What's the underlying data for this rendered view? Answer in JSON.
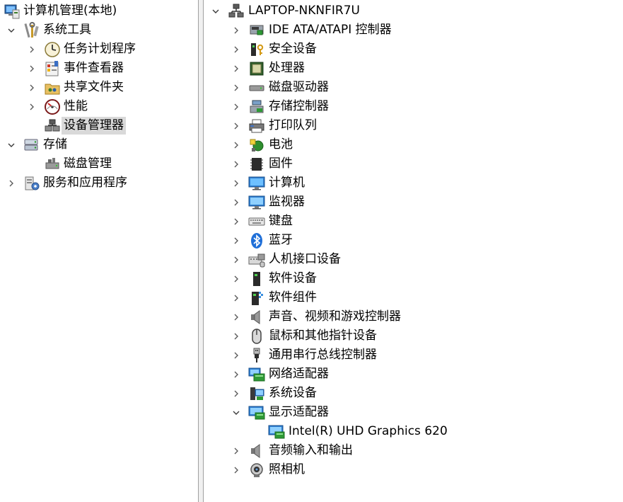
{
  "left_tree": {
    "root": {
      "label": "计算机管理(本地)",
      "icon": "computer-management-icon"
    },
    "items": [
      {
        "label": "系统工具",
        "icon": "system-tools-icon",
        "state": "expanded"
      },
      {
        "label": "任务计划程序",
        "icon": "task-scheduler-icon",
        "state": "collapsed"
      },
      {
        "label": "事件查看器",
        "icon": "event-viewer-icon",
        "state": "collapsed"
      },
      {
        "label": "共享文件夹",
        "icon": "shared-folders-icon",
        "state": "collapsed"
      },
      {
        "label": "性能",
        "icon": "performance-icon",
        "state": "collapsed"
      },
      {
        "label": "设备管理器",
        "icon": "device-manager-icon",
        "state": "leaf",
        "selected": true
      },
      {
        "label": "存储",
        "icon": "storage-icon",
        "state": "expanded"
      },
      {
        "label": "磁盘管理",
        "icon": "disk-management-icon",
        "state": "leaf"
      },
      {
        "label": "服务和应用程序",
        "icon": "services-applications-icon",
        "state": "collapsed"
      }
    ]
  },
  "device_tree": {
    "root": {
      "label": "LAPTOP-NKNFIR7U",
      "icon": "computer-network-icon",
      "state": "expanded"
    },
    "categories": [
      {
        "label": "IDE ATA/ATAPI 控制器",
        "icon": "ide-controller-icon",
        "state": "collapsed"
      },
      {
        "label": "安全设备",
        "icon": "security-device-icon",
        "state": "collapsed"
      },
      {
        "label": "处理器",
        "icon": "processor-icon",
        "state": "collapsed"
      },
      {
        "label": "磁盘驱动器",
        "icon": "disk-drive-icon",
        "state": "collapsed"
      },
      {
        "label": "存储控制器",
        "icon": "storage-controller-icon",
        "state": "collapsed"
      },
      {
        "label": "打印队列",
        "icon": "printer-icon",
        "state": "collapsed"
      },
      {
        "label": "电池",
        "icon": "battery-icon",
        "state": "collapsed"
      },
      {
        "label": "固件",
        "icon": "firmware-icon",
        "state": "collapsed"
      },
      {
        "label": "计算机",
        "icon": "computer-icon",
        "state": "collapsed"
      },
      {
        "label": "监视器",
        "icon": "monitor-icon",
        "state": "collapsed"
      },
      {
        "label": "键盘",
        "icon": "keyboard-icon",
        "state": "collapsed"
      },
      {
        "label": "蓝牙",
        "icon": "bluetooth-icon",
        "state": "collapsed"
      },
      {
        "label": "人机接口设备",
        "icon": "hid-icon",
        "state": "collapsed"
      },
      {
        "label": "软件设备",
        "icon": "software-device-icon",
        "state": "collapsed"
      },
      {
        "label": "软件组件",
        "icon": "software-component-icon",
        "state": "collapsed"
      },
      {
        "label": "声音、视频和游戏控制器",
        "icon": "speaker-icon",
        "state": "collapsed"
      },
      {
        "label": "鼠标和其他指针设备",
        "icon": "mouse-icon",
        "state": "collapsed"
      },
      {
        "label": "通用串行总线控制器",
        "icon": "usb-icon",
        "state": "collapsed"
      },
      {
        "label": "网络适配器",
        "icon": "network-adapter-icon",
        "state": "collapsed"
      },
      {
        "label": "系统设备",
        "icon": "system-device-icon",
        "state": "collapsed"
      },
      {
        "label": "显示适配器",
        "icon": "display-adapter-icon",
        "state": "expanded",
        "children": [
          {
            "label": "Intel(R) UHD Graphics 620",
            "icon": "display-adapter-icon"
          }
        ]
      },
      {
        "label": "音频输入和输出",
        "icon": "speaker-icon",
        "state": "collapsed"
      },
      {
        "label": "照相机",
        "icon": "camera-icon",
        "state": "collapsed"
      }
    ]
  },
  "colors": {
    "selection": "#d9d9d9",
    "splitter": "#f0f0f0",
    "splitter_border": "#a0a0a0",
    "chevron": "#5a5a5a"
  }
}
